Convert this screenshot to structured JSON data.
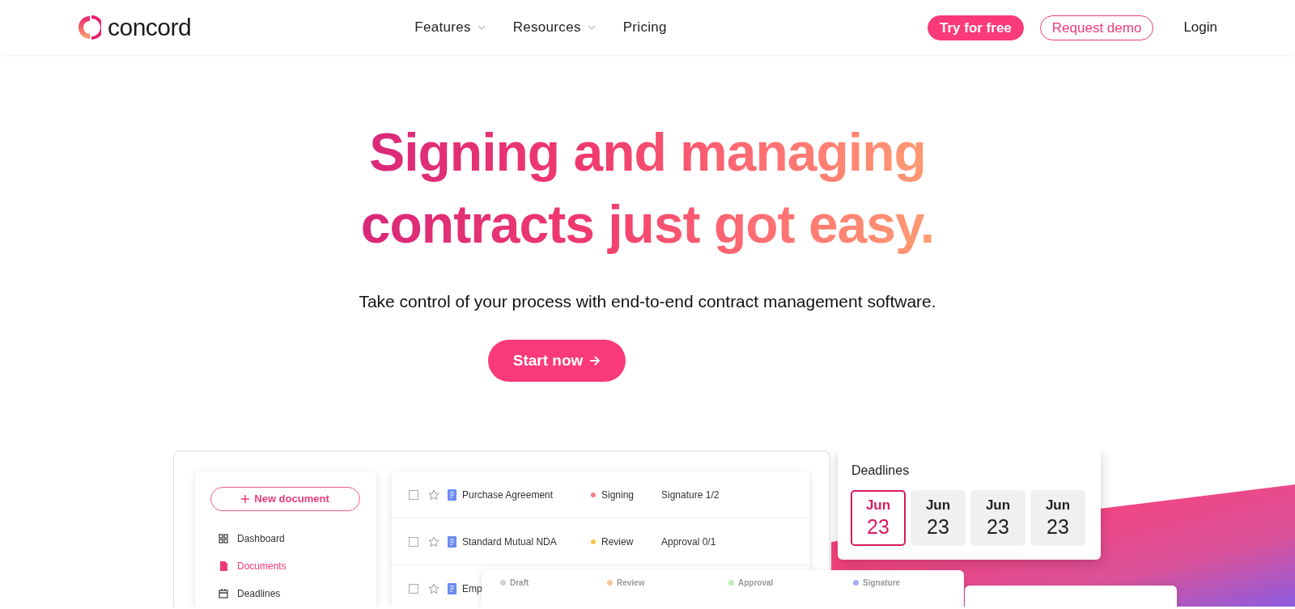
{
  "nav": {
    "logo": "concord",
    "links": [
      {
        "label": "Features",
        "dropdown": true
      },
      {
        "label": "Resources",
        "dropdown": true
      },
      {
        "label": "Pricing",
        "dropdown": false
      }
    ],
    "buttons": [
      {
        "label": "Try for free",
        "kind": "solid"
      },
      {
        "label": "Request demo",
        "kind": "outline"
      },
      {
        "label": "Login",
        "kind": "plain"
      }
    ]
  },
  "hero": {
    "title_lines": [
      "Signing and managing",
      "contracts just got easy."
    ],
    "subtitle": "Take control of your process with end-to-end contract management software.",
    "cta": "Start now"
  },
  "app": {
    "new_document": "New document",
    "sidebar_items": [
      {
        "label": "Dashboard",
        "selected": false
      },
      {
        "label": "Documents",
        "selected": true
      },
      {
        "label": "Deadlines",
        "selected": false
      }
    ],
    "documents": [
      {
        "name": "Purchase Agreement",
        "checked": false,
        "starred": false,
        "status": "Signing",
        "color": "#f47f86",
        "progress": "Signature 1/2"
      },
      {
        "name": "Standard Mutual NDA",
        "checked": false,
        "starred": false,
        "status": "Review",
        "color": "#fbc846",
        "progress": "Approval 0/1"
      },
      {
        "name": "Emp",
        "checked": false,
        "starred": false
      }
    ],
    "deadlines": {
      "title": "Deadlines",
      "dates": [
        {
          "month": "Jun",
          "day": "23",
          "selected": true
        },
        {
          "month": "Jun",
          "day": "23",
          "selected": false
        },
        {
          "month": "Jun",
          "day": "23",
          "selected": false
        },
        {
          "month": "Jun",
          "day": "23",
          "selected": false
        }
      ]
    },
    "stages": [
      {
        "label": "Draft",
        "color": "#d0d2d6"
      },
      {
        "label": "Review",
        "color": "#f9c99a"
      },
      {
        "label": "Approval",
        "color": "#bfeabb"
      },
      {
        "label": "Signature",
        "color": "#a6abf5"
      }
    ]
  }
}
